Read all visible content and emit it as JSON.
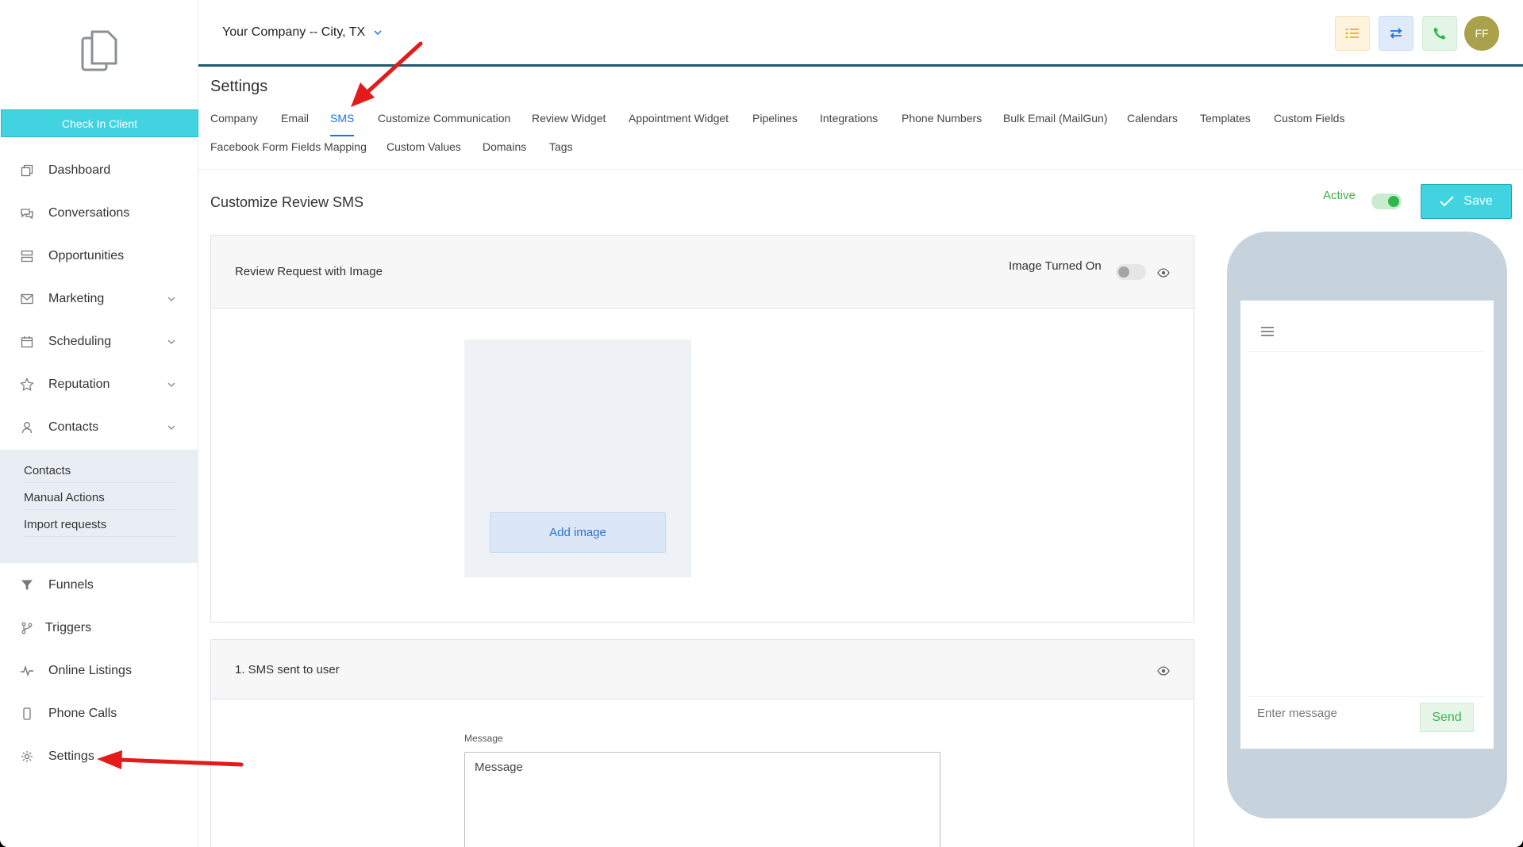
{
  "sidebar": {
    "check_in_label": "Check In Client",
    "items": [
      {
        "label": "Dashboard",
        "icon": "dashboard-icon"
      },
      {
        "label": "Conversations",
        "icon": "chat-icon"
      },
      {
        "label": "Opportunities",
        "icon": "stack-icon"
      },
      {
        "label": "Marketing",
        "icon": "mail-icon"
      },
      {
        "label": "Scheduling",
        "icon": "calendar-icon"
      },
      {
        "label": "Reputation",
        "icon": "star-icon"
      },
      {
        "label": "Contacts",
        "icon": "user-icon"
      },
      {
        "label": "Funnels",
        "icon": "filter-icon"
      },
      {
        "label": "Triggers",
        "icon": "branch-icon"
      },
      {
        "label": "Online Listings",
        "icon": "pulse-icon"
      },
      {
        "label": "Phone Calls",
        "icon": "phone-icon"
      },
      {
        "label": "Settings",
        "icon": "gear-icon"
      }
    ],
    "contacts_sub": [
      "Contacts",
      "Manual Actions",
      "Import requests"
    ]
  },
  "header": {
    "company": "Your Company -- City, TX",
    "avatar_initials": "FF",
    "colors": {
      "list": "#f5a623",
      "transfer": "#1a73e8",
      "phone": "#2eb84c",
      "avatar": "#a9a14b"
    }
  },
  "settings": {
    "title": "Settings",
    "tabs_row1": [
      "Company",
      "Email",
      "SMS",
      "Customize Communication",
      "Review Widget",
      "Appointment Widget",
      "Pipelines",
      "Integrations",
      "Phone Numbers",
      "Bulk Email (MailGun)",
      "Calendars",
      "Templates",
      "Custom Fields"
    ],
    "tabs_row2": [
      "Facebook Form Fields Mapping",
      "Custom Values",
      "Domains",
      "Tags"
    ],
    "active_tab": "SMS"
  },
  "main": {
    "section_title": "Customize Review SMS",
    "active_label": "Active",
    "active_on": true,
    "save_label": "Save",
    "card1": {
      "title": "Review Request with Image",
      "image_toggle_label": "Image Turned On",
      "image_on": false,
      "add_image_label": "Add image"
    },
    "card2": {
      "title": "1. SMS sent to user",
      "message_label": "Message",
      "message_placeholder": "Message"
    }
  },
  "phone_preview": {
    "input_placeholder": "Enter message",
    "send_label": "Send"
  }
}
